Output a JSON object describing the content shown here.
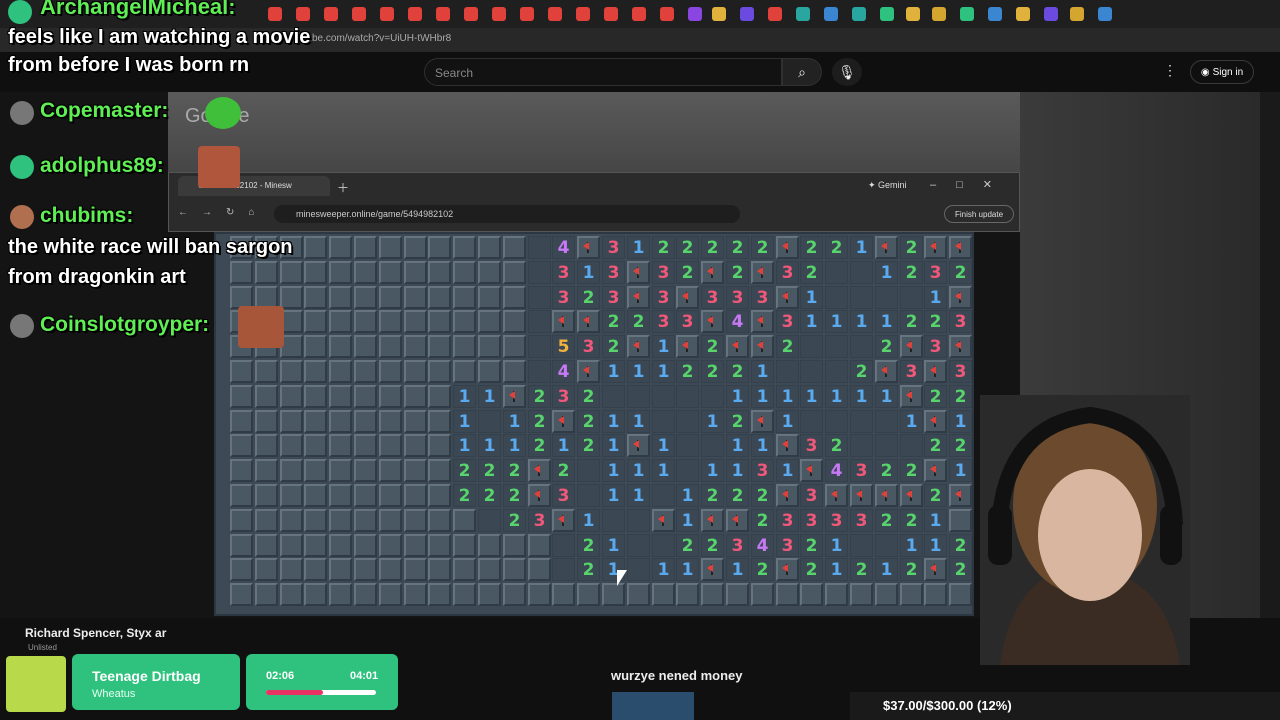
{
  "outer": {
    "url": "be.com/watch?v=UiUH-tWHbr8"
  },
  "youtube": {
    "search_placeholder": "Search",
    "sign_in": "Sign in",
    "channel_line": "Richard Spencer, Styx ar",
    "unlisted": "Unlisted"
  },
  "inner_browser": {
    "tab_title": "G... 5494982102 - Minesw",
    "address": "minesweeper.online/game/5494982102",
    "gemini": "Gemini",
    "finish_update": "Finish update"
  },
  "background_text": "Google",
  "chat": [
    {
      "user": "ArchangelMicheal:",
      "message": "feels like I am watching a movie"
    },
    {
      "user": "",
      "message": "from before I was born rn"
    },
    {
      "user": "Copemaster:",
      "message": ""
    },
    {
      "user": "adolphus89:",
      "message": ""
    },
    {
      "user": "chubims:",
      "message": ""
    },
    {
      "user": "",
      "message": "the white race will ban sargon"
    },
    {
      "user": "",
      "message": "from dragonkin art"
    },
    {
      "user": "Coinslotgroyper:",
      "message": ""
    }
  ],
  "board": {
    "rows": [
      "HHHHHHHHHHHHR4F3122222F221F2FF1H",
      "HHHHHHHHHHHHR313F32F2F32RR1232F1",
      "HHHHHHHHHHHHR323F3F333F1RRRR1F1",
      "HHHHHHHHHHHHRFF2233F4F3111122322",
      "HHHHHHHHHHHHR532F1F2FF2RRR2F3F3F2",
      "HHHHHHHHHHHHR4F1112221RRR2F3F3F2",
      "HHHHHHHHH11F232RRRRR1111111F2221",
      "HHHHHHHHH1R12F211RR12F1RRRR1F1",
      "HHHHHHHHH1112121F1RR11F32RRR222",
      "HHHHHHHHH222F2R111R1131F4322F1",
      "HHHHHHHHH222F3R11R1222F3FFFF2F1R1",
      "HHHHHHHHHHR23F1RRF1FF23333221HR22",
      "HHHHHHHHHHHHHR21RR2234321RR112HH",
      "HHHHHHHHHHHHHR21R11F12F21212F2HH",
      "HHHHHHHHHHHHHHHHHHHHHHHHHHHHHHH"
    ],
    "colors": {
      "1": "#5aaaf0",
      "2": "#57d46c",
      "3": "#f0587a",
      "4": "#c779f5",
      "5": "#f0b23c"
    }
  },
  "song": {
    "title": "Teenage Dirtbag",
    "artist": "Wheatus",
    "current": "02:06",
    "total": "04:01",
    "progress": 0.52
  },
  "stream": {
    "tts": "wurzye nened money",
    "donation_goal": "$37.00/$300.00 (12%)"
  }
}
